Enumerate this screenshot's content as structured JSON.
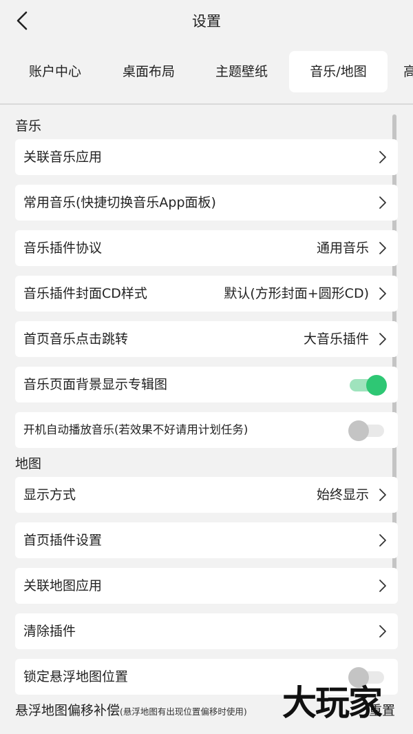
{
  "header": {
    "title": "设置"
  },
  "tabs": [
    {
      "label": "账户中心"
    },
    {
      "label": "桌面布局"
    },
    {
      "label": "主题壁纸"
    },
    {
      "label": "音乐/地图"
    },
    {
      "label": "高"
    }
  ],
  "sections": {
    "music": {
      "title": "音乐",
      "items": [
        {
          "label": "关联音乐应用",
          "value": ""
        },
        {
          "label": "常用音乐(快捷切换音乐App面板)",
          "value": ""
        },
        {
          "label": "音乐插件协议",
          "value": "通用音乐"
        },
        {
          "label": "音乐插件封面CD样式",
          "value": "默认(方形封面+圆形CD)"
        },
        {
          "label": "首页音乐点击跳转",
          "value": "大音乐插件"
        },
        {
          "label": "音乐页面背景显示专辑图",
          "toggle": true
        },
        {
          "label": "开机自动播放音乐(若效果不好请用计划任务)",
          "toggle": false
        }
      ]
    },
    "map": {
      "title": "地图",
      "items": [
        {
          "label": "显示方式",
          "value": "始终显示"
        },
        {
          "label": "首页插件设置",
          "value": ""
        },
        {
          "label": "关联地图应用",
          "value": ""
        },
        {
          "label": "清除插件",
          "value": ""
        },
        {
          "label": "锁定悬浮地图位置",
          "toggle": false
        }
      ],
      "offset": {
        "label": "悬浮地图偏移补偿",
        "note": "(悬浮地图有出现位置偏移时使用)",
        "action": "重置"
      }
    }
  },
  "watermark": "大玩家",
  "colors": {
    "accent": "#2ec774",
    "background": "#f2f2f2",
    "card": "#ffffff"
  }
}
